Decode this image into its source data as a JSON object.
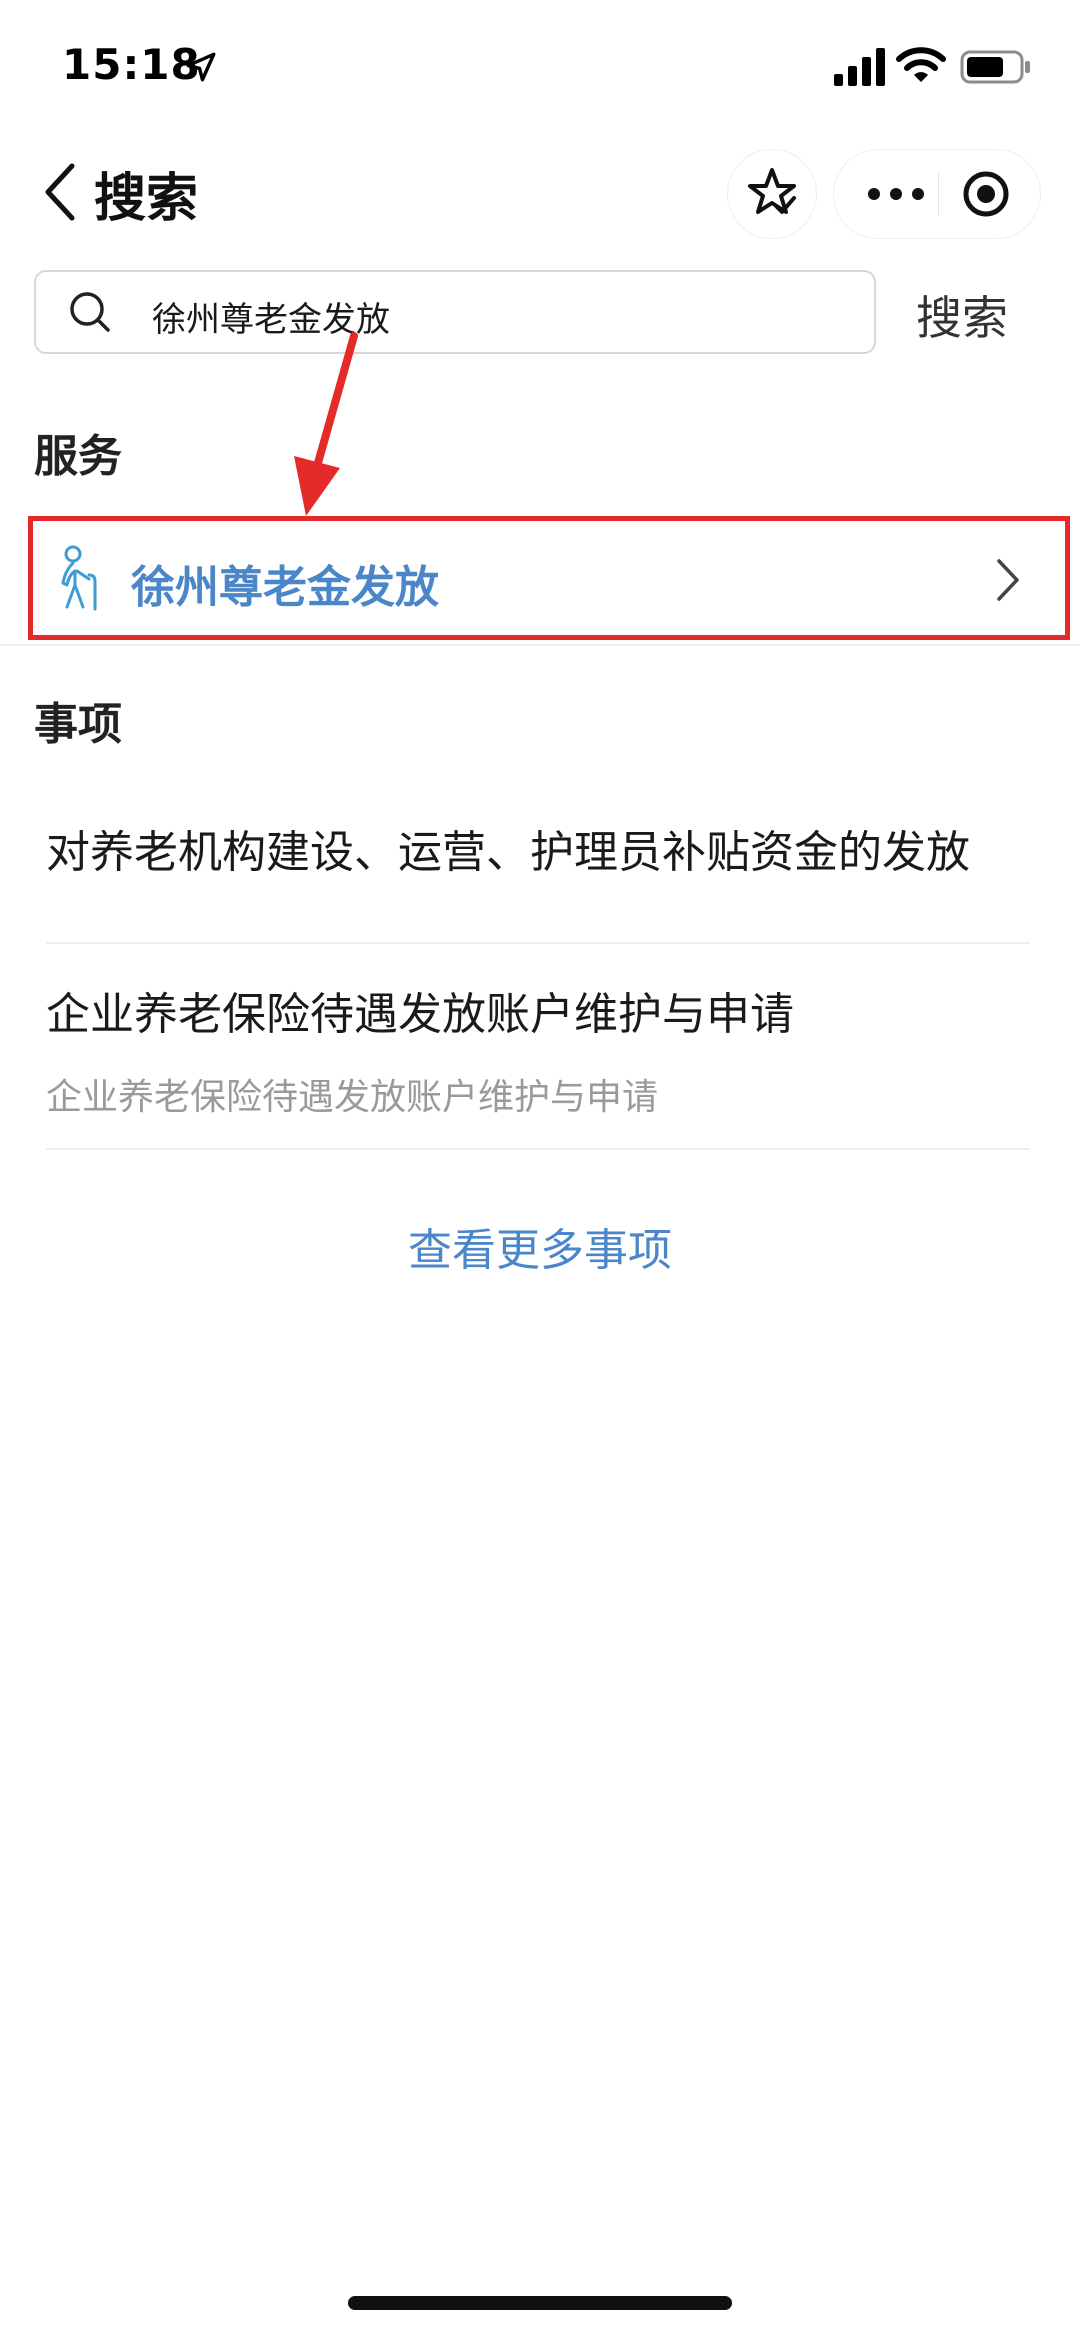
{
  "status_bar": {
    "time": "15:18"
  },
  "nav": {
    "title": "搜索"
  },
  "search": {
    "query": "徐州尊老金发放",
    "submit_label": "搜索"
  },
  "services": {
    "heading": "服务",
    "items": [
      {
        "label": "徐州尊老金发放",
        "icon": "elderly-person-icon",
        "highlight_color": "#e52a2a"
      }
    ]
  },
  "matters": {
    "heading": "事项",
    "items": [
      {
        "title": "对养老机构建设、运营、护理员补贴资金的发放",
        "subtitle": ""
      },
      {
        "title": "企业养老保险待遇发放账户维护与申请",
        "subtitle": "企业养老保险待遇发放账户维护与申请"
      }
    ],
    "more_label": "查看更多事项"
  },
  "colors": {
    "accent": "#4a86c8",
    "annotation": "#e52a2a"
  }
}
